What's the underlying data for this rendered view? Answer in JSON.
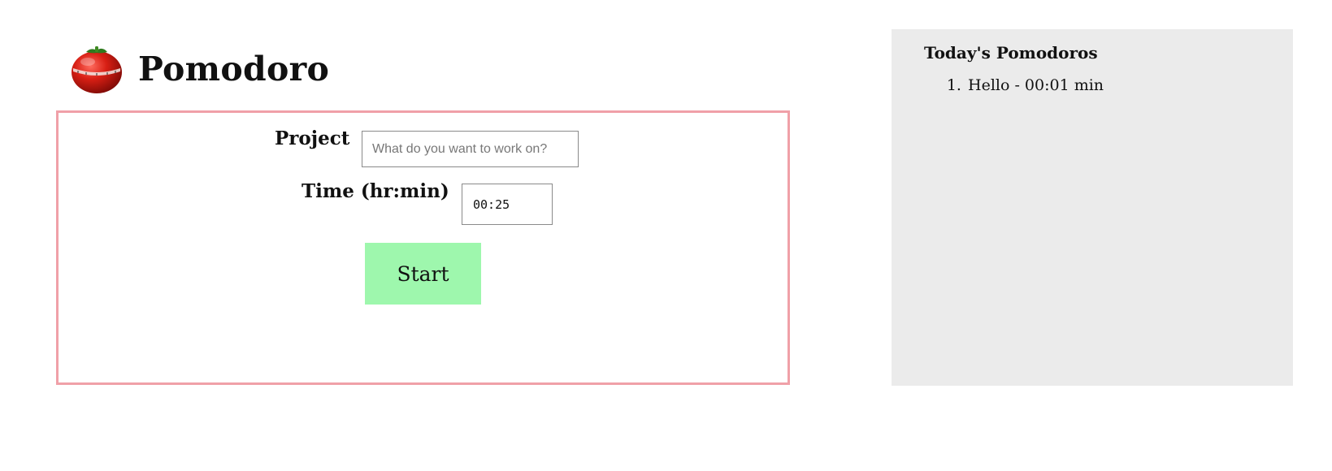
{
  "header": {
    "logo_icon": "tomato-timer-icon",
    "title": "Pomodoro"
  },
  "form": {
    "project_label": "Project",
    "project_value": "",
    "project_placeholder": "What do you want to work on?",
    "time_label": "Time (hr:min)",
    "time_value": "00:25",
    "start_label": "Start"
  },
  "sidebar": {
    "title": "Today's Pomodoros",
    "items": [
      {
        "text": "Hello - 00:01 min"
      }
    ]
  },
  "colors": {
    "panel_border": "#f0a0a8",
    "start_button": "#9ef7ad",
    "sidebar_background": "#ebebeb"
  }
}
